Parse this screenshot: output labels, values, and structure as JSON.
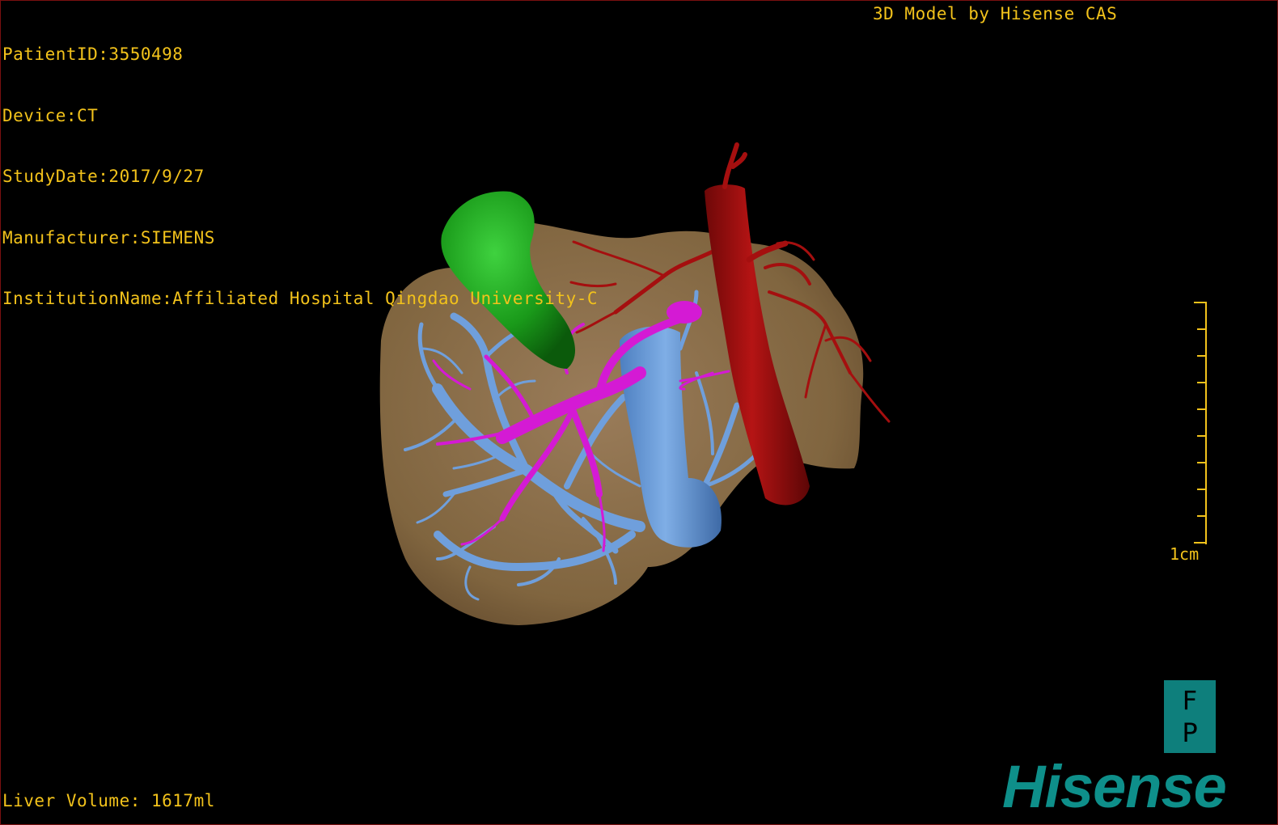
{
  "dicom_info": {
    "patient_id": "PatientID:3550498",
    "device": "Device:CT",
    "study_date": "StudyDate:2017/9/27",
    "manufacturer": "Manufacturer:SIEMENS",
    "institution": "InstitutionName:Affiliated Hospital Qingdao University-C"
  },
  "model_credit": "3D Model by Hisense CAS",
  "liver_volume": "Liver Volume: 1617ml",
  "scale_bar": {
    "label": "1cm"
  },
  "orientation": {
    "top": "F",
    "bottom": "P"
  },
  "brand": "Hisense",
  "colors": {
    "overlay_text": "#f2c21b",
    "liver": "#8a6e4e",
    "gallbladder": "#1fa81f",
    "hepatic_veins": "#6f9fdc",
    "portal_vein": "#d41ad4",
    "artery": "#a50f0f",
    "brand": "#0e8f8a"
  },
  "icons": {
    "liver_model": "liver-3d-model",
    "scale_bar": "scale-bar-icon",
    "orientation": "orientation-cube-icon"
  }
}
